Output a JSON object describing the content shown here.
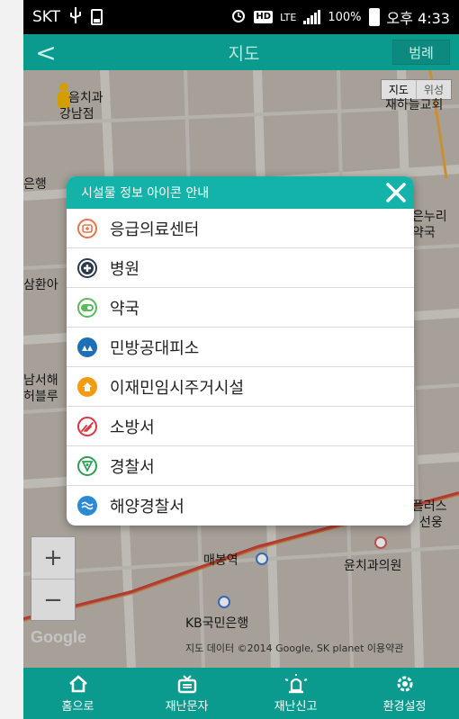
{
  "status": {
    "carrier": "SKT",
    "battery": "100%",
    "lte": "LTE",
    "time": "오후 4:33"
  },
  "header": {
    "back": "<",
    "title": "지도",
    "legend_button": "범례"
  },
  "map": {
    "type_map": "지도",
    "type_satellite": "위성",
    "labels": {
      "dental": "음치과",
      "gangnam": "강남점",
      "church": "재하늘교회",
      "bank_left": "은행",
      "nuri": "은누리",
      "guk": "약국",
      "samhwan": "삼환아",
      "namseo": "남서해",
      "blue": "허블루",
      "plus": "플러스",
      "sunwoong": "선웅",
      "maebong": "매봉역",
      "yunchi": "윤치과의원",
      "kb": "KB국민은행"
    },
    "zoom_in": "+",
    "zoom_out": "−",
    "google": "Google",
    "attribution": "지도 데이터 ©2014 Google, SK planet   이용약관"
  },
  "dialog": {
    "title": "시설물 정보 아이콘 안내",
    "items": [
      {
        "label": "응급의료센터",
        "color": "#e8734a",
        "icon": "emergency-icon"
      },
      {
        "label": "병원",
        "color": "#2b3a4a",
        "icon": "hospital-cross-icon"
      },
      {
        "label": "약국",
        "color": "#5cb85c",
        "icon": "pharmacy-pill-icon"
      },
      {
        "label": "민방공대피소",
        "color": "#1f6fb5",
        "icon": "shelter-icon"
      },
      {
        "label": "이재민임시주거시설",
        "color": "#f39c12",
        "icon": "temporary-housing-icon"
      },
      {
        "label": "소방서",
        "color": "#d9363e",
        "icon": "fire-station-icon"
      },
      {
        "label": "경찰서",
        "color": "#2e9e55",
        "icon": "police-icon"
      },
      {
        "label": "해양경찰서",
        "color": "#2a8ad4",
        "icon": "coast-guard-icon"
      }
    ]
  },
  "bottom": {
    "tabs": [
      {
        "label": "홈으로",
        "icon": "home-icon"
      },
      {
        "label": "재난문자",
        "icon": "tv-icon"
      },
      {
        "label": "재난신고",
        "icon": "siren-icon"
      },
      {
        "label": "환경설정",
        "icon": "gear-icon"
      }
    ]
  },
  "colors": {
    "accent": "#0b9a8e",
    "dialog_header": "#14b3aa"
  }
}
